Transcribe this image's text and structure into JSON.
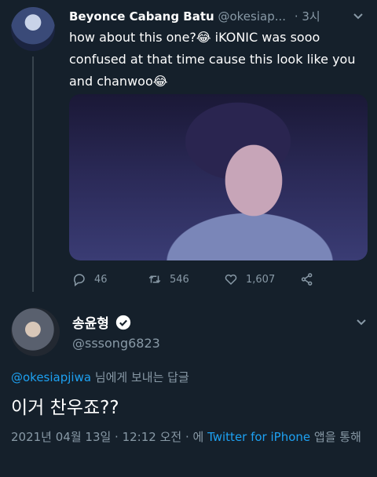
{
  "tweet1": {
    "display_name": "Beyonce Cabang Batu",
    "handle": "@okesiap...",
    "separator": "·",
    "time": "3시",
    "text": "how about this one?😂 iKONIC was sooo confused at that time cause this look like you and chanwoo😂",
    "actions": {
      "replies": "46",
      "retweets": "546",
      "likes": "1,607"
    }
  },
  "tweet2": {
    "display_name": "송윤형",
    "handle": "@sssong6823",
    "reply_mention": "@okesiapjiwa",
    "reply_suffix": " 님에게 보내는 답글",
    "text": "이거 찬우죠??",
    "meta_prefix": "2021년 04월 13일 · 12:12 오전 · 에 ",
    "meta_source": "Twitter for iPhone",
    "meta_suffix": " 앱을 통해"
  },
  "colors": {
    "background": "#15202b",
    "muted": "#8899a6",
    "accent": "#1da1f2"
  }
}
